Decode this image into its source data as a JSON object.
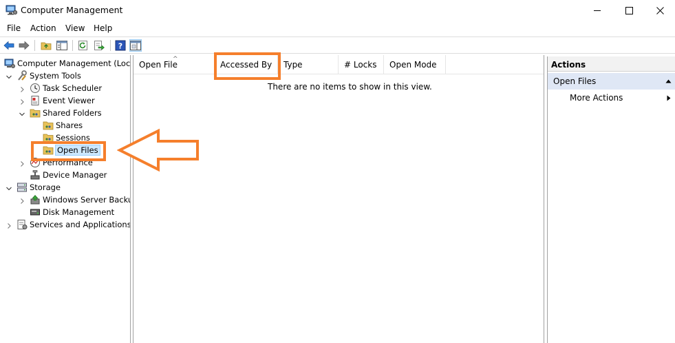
{
  "window": {
    "title": "Computer Management",
    "minimize_glyph": "—",
    "maximize_glyph": "☐",
    "close_glyph": "✕"
  },
  "menu": [
    {
      "label": "File"
    },
    {
      "label": "Action"
    },
    {
      "label": "View"
    },
    {
      "label": "Help"
    }
  ],
  "toolbar": {
    "icons": [
      "back-icon",
      "forward-icon",
      "up-folder-icon",
      "show-hide-tree-icon",
      "refresh-icon",
      "export-list-icon",
      "help-icon",
      "show-hide-action-pane-icon"
    ]
  },
  "tree": {
    "root": "Computer Management (Local",
    "system_tools": "System Tools",
    "task_scheduler": "Task Scheduler",
    "event_viewer": "Event Viewer",
    "shared_folders": "Shared Folders",
    "shares": "Shares",
    "sessions": "Sessions",
    "open_files": "Open Files",
    "performance": "Performance",
    "device_manager": "Device Manager",
    "storage": "Storage",
    "windows_server_backup": "Windows Server Backup",
    "disk_management": "Disk Management",
    "services_apps": "Services and Applications",
    "selected": "Open Files"
  },
  "columns": [
    {
      "label": "Open File"
    },
    {
      "label": "Accessed By"
    },
    {
      "label": "Type"
    },
    {
      "label": "# Locks"
    },
    {
      "label": "Open Mode"
    }
  ],
  "empty_message": "There are no items to show in this view.",
  "actions": {
    "header": "Actions",
    "section": "Open Files",
    "more": "More Actions"
  },
  "annotation": {
    "color": "#f57f2c"
  },
  "colors": {
    "selection": "#cce8ff",
    "action_section_bg": "#dfe7f5",
    "accent_blue": "#0078d7"
  }
}
